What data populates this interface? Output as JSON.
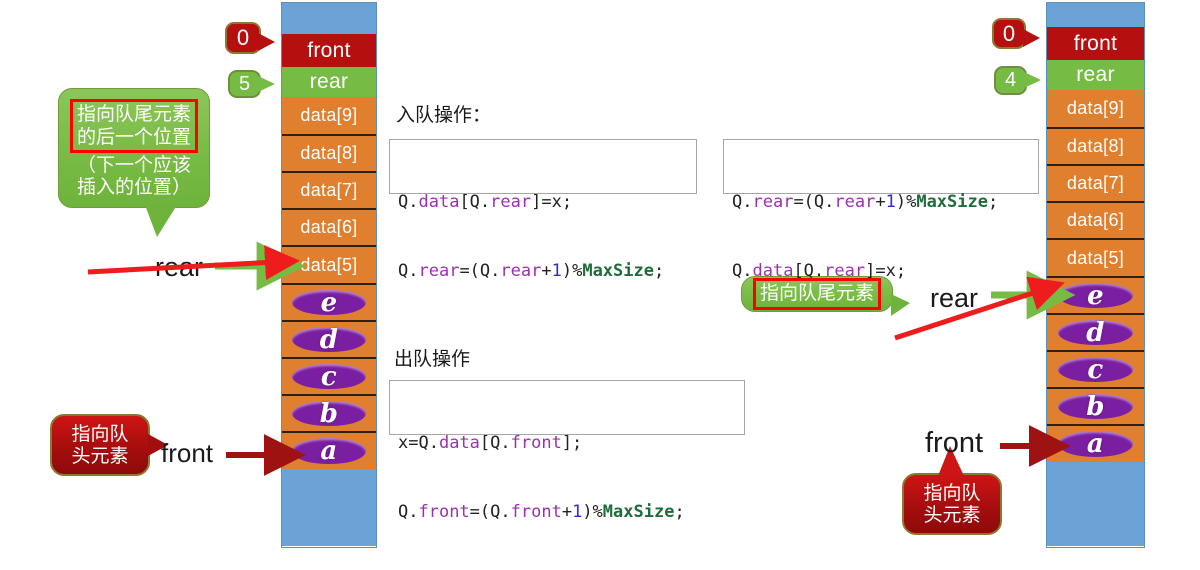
{
  "left_queue": {
    "front_label": "front",
    "rear_label": "rear",
    "front_badge": "0",
    "rear_badge": "5",
    "data_cells": [
      "data[9]",
      "data[8]",
      "data[7]",
      "data[6]",
      "data[5]"
    ],
    "items": [
      "e",
      "d",
      "c",
      "b",
      "a"
    ],
    "rear_pointer_text": "rear",
    "front_pointer_text": "front"
  },
  "right_queue": {
    "front_label": "front",
    "rear_label": "rear",
    "front_badge": "0",
    "rear_badge": "4",
    "data_cells": [
      "data[9]",
      "data[8]",
      "data[7]",
      "data[6]",
      "data[5]"
    ],
    "items": [
      "e",
      "d",
      "c",
      "b",
      "a"
    ],
    "rear_pointer_text": "rear",
    "front_pointer_text": "front"
  },
  "callouts": {
    "left_rear_note": {
      "line1": "指向队尾元素",
      "line2": "的后一个位置",
      "line3": "（下一个应该",
      "line4": "插入的位置）"
    },
    "left_front_note": {
      "line1": "指向队",
      "line2": "头元素"
    },
    "right_rear_note": {
      "line1": "指向队尾元素"
    },
    "right_front_note": {
      "line1": "指向队",
      "line2": "头元素"
    }
  },
  "enqueue": {
    "title": "入队操作：",
    "box_a": {
      "line1": {
        "p1": "Q.",
        "p2": "data",
        "p3": "[Q.",
        "p4": "rear",
        "p5": "]=x;"
      },
      "line2": {
        "p1": "Q.",
        "p2": "rear",
        "p3": "=(Q.",
        "p4": "rear",
        "p5": "+",
        "p6": "1",
        "p7": ")%",
        "p8": "MaxSize",
        "p9": ";"
      }
    },
    "box_b": {
      "line1": {
        "p1": "Q.",
        "p2": "rear",
        "p3": "=(Q.",
        "p4": "rear",
        "p5": "+",
        "p6": "1",
        "p7": ")%",
        "p8": "MaxSize",
        "p9": ";"
      },
      "line2": {
        "p1": "Q.",
        "p2": "data",
        "p3": "[Q.",
        "p4": "rear",
        "p5": "]=x;"
      }
    }
  },
  "dequeue": {
    "title": "出队操作",
    "box": {
      "line1": {
        "p1": "x=Q.",
        "p2": "data",
        "p3": "[Q.",
        "p4": "front",
        "p5": "];"
      },
      "line2": {
        "p1": "Q.",
        "p2": "front",
        "p3": "=(Q.",
        "p4": "front",
        "p5": "+",
        "p6": "1",
        "p7": ")%",
        "p8": "MaxSize",
        "p9": ";"
      }
    }
  },
  "colors": {
    "front_cell": "#b50f0f",
    "rear_cell": "#76bb44",
    "data_cell": "#e0802f",
    "blue_cell": "#6ba3d6",
    "item_ellipse": "#7b1fa2",
    "red_arrow": "#ee1c1c",
    "dark_red_arrow": "#9e1212",
    "green_arrow": "#76bb44",
    "code_var": "#9b30b0",
    "code_num": "#2b2bd8",
    "code_const": "#1f6b3a"
  }
}
